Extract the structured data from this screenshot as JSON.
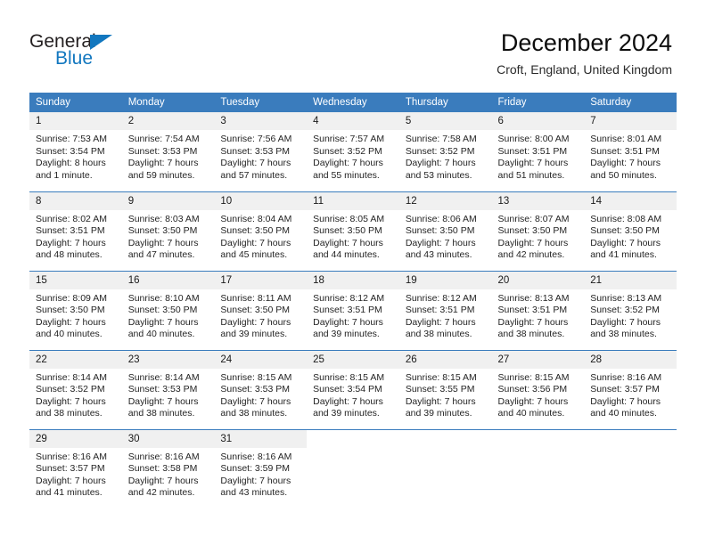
{
  "brand": {
    "word_general": "General",
    "word_blue": "Blue",
    "triangle_color": "#1277bf"
  },
  "header": {
    "title": "December 2024",
    "subtitle": "Croft, England, United Kingdom",
    "accent_color": "#3a7cbd",
    "daynum_band_color": "#f0f0f0"
  },
  "labels": {
    "sunrise_prefix": "Sunrise:",
    "sunset_prefix": "Sunset:",
    "daylight_prefix": "Daylight:"
  },
  "calendar": {
    "weekday_headers": [
      "Sunday",
      "Monday",
      "Tuesday",
      "Wednesday",
      "Thursday",
      "Friday",
      "Saturday"
    ],
    "weeks": [
      [
        {
          "day": "1",
          "sunrise": "Sunrise: 7:53 AM",
          "sunset": "Sunset: 3:54 PM",
          "daylight_l1": "Daylight: 8 hours",
          "daylight_l2": "and 1 minute."
        },
        {
          "day": "2",
          "sunrise": "Sunrise: 7:54 AM",
          "sunset": "Sunset: 3:53 PM",
          "daylight_l1": "Daylight: 7 hours",
          "daylight_l2": "and 59 minutes."
        },
        {
          "day": "3",
          "sunrise": "Sunrise: 7:56 AM",
          "sunset": "Sunset: 3:53 PM",
          "daylight_l1": "Daylight: 7 hours",
          "daylight_l2": "and 57 minutes."
        },
        {
          "day": "4",
          "sunrise": "Sunrise: 7:57 AM",
          "sunset": "Sunset: 3:52 PM",
          "daylight_l1": "Daylight: 7 hours",
          "daylight_l2": "and 55 minutes."
        },
        {
          "day": "5",
          "sunrise": "Sunrise: 7:58 AM",
          "sunset": "Sunset: 3:52 PM",
          "daylight_l1": "Daylight: 7 hours",
          "daylight_l2": "and 53 minutes."
        },
        {
          "day": "6",
          "sunrise": "Sunrise: 8:00 AM",
          "sunset": "Sunset: 3:51 PM",
          "daylight_l1": "Daylight: 7 hours",
          "daylight_l2": "and 51 minutes."
        },
        {
          "day": "7",
          "sunrise": "Sunrise: 8:01 AM",
          "sunset": "Sunset: 3:51 PM",
          "daylight_l1": "Daylight: 7 hours",
          "daylight_l2": "and 50 minutes."
        }
      ],
      [
        {
          "day": "8",
          "sunrise": "Sunrise: 8:02 AM",
          "sunset": "Sunset: 3:51 PM",
          "daylight_l1": "Daylight: 7 hours",
          "daylight_l2": "and 48 minutes."
        },
        {
          "day": "9",
          "sunrise": "Sunrise: 8:03 AM",
          "sunset": "Sunset: 3:50 PM",
          "daylight_l1": "Daylight: 7 hours",
          "daylight_l2": "and 47 minutes."
        },
        {
          "day": "10",
          "sunrise": "Sunrise: 8:04 AM",
          "sunset": "Sunset: 3:50 PM",
          "daylight_l1": "Daylight: 7 hours",
          "daylight_l2": "and 45 minutes."
        },
        {
          "day": "11",
          "sunrise": "Sunrise: 8:05 AM",
          "sunset": "Sunset: 3:50 PM",
          "daylight_l1": "Daylight: 7 hours",
          "daylight_l2": "and 44 minutes."
        },
        {
          "day": "12",
          "sunrise": "Sunrise: 8:06 AM",
          "sunset": "Sunset: 3:50 PM",
          "daylight_l1": "Daylight: 7 hours",
          "daylight_l2": "and 43 minutes."
        },
        {
          "day": "13",
          "sunrise": "Sunrise: 8:07 AM",
          "sunset": "Sunset: 3:50 PM",
          "daylight_l1": "Daylight: 7 hours",
          "daylight_l2": "and 42 minutes."
        },
        {
          "day": "14",
          "sunrise": "Sunrise: 8:08 AM",
          "sunset": "Sunset: 3:50 PM",
          "daylight_l1": "Daylight: 7 hours",
          "daylight_l2": "and 41 minutes."
        }
      ],
      [
        {
          "day": "15",
          "sunrise": "Sunrise: 8:09 AM",
          "sunset": "Sunset: 3:50 PM",
          "daylight_l1": "Daylight: 7 hours",
          "daylight_l2": "and 40 minutes."
        },
        {
          "day": "16",
          "sunrise": "Sunrise: 8:10 AM",
          "sunset": "Sunset: 3:50 PM",
          "daylight_l1": "Daylight: 7 hours",
          "daylight_l2": "and 40 minutes."
        },
        {
          "day": "17",
          "sunrise": "Sunrise: 8:11 AM",
          "sunset": "Sunset: 3:50 PM",
          "daylight_l1": "Daylight: 7 hours",
          "daylight_l2": "and 39 minutes."
        },
        {
          "day": "18",
          "sunrise": "Sunrise: 8:12 AM",
          "sunset": "Sunset: 3:51 PM",
          "daylight_l1": "Daylight: 7 hours",
          "daylight_l2": "and 39 minutes."
        },
        {
          "day": "19",
          "sunrise": "Sunrise: 8:12 AM",
          "sunset": "Sunset: 3:51 PM",
          "daylight_l1": "Daylight: 7 hours",
          "daylight_l2": "and 38 minutes."
        },
        {
          "day": "20",
          "sunrise": "Sunrise: 8:13 AM",
          "sunset": "Sunset: 3:51 PM",
          "daylight_l1": "Daylight: 7 hours",
          "daylight_l2": "and 38 minutes."
        },
        {
          "day": "21",
          "sunrise": "Sunrise: 8:13 AM",
          "sunset": "Sunset: 3:52 PM",
          "daylight_l1": "Daylight: 7 hours",
          "daylight_l2": "and 38 minutes."
        }
      ],
      [
        {
          "day": "22",
          "sunrise": "Sunrise: 8:14 AM",
          "sunset": "Sunset: 3:52 PM",
          "daylight_l1": "Daylight: 7 hours",
          "daylight_l2": "and 38 minutes."
        },
        {
          "day": "23",
          "sunrise": "Sunrise: 8:14 AM",
          "sunset": "Sunset: 3:53 PM",
          "daylight_l1": "Daylight: 7 hours",
          "daylight_l2": "and 38 minutes."
        },
        {
          "day": "24",
          "sunrise": "Sunrise: 8:15 AM",
          "sunset": "Sunset: 3:53 PM",
          "daylight_l1": "Daylight: 7 hours",
          "daylight_l2": "and 38 minutes."
        },
        {
          "day": "25",
          "sunrise": "Sunrise: 8:15 AM",
          "sunset": "Sunset: 3:54 PM",
          "daylight_l1": "Daylight: 7 hours",
          "daylight_l2": "and 39 minutes."
        },
        {
          "day": "26",
          "sunrise": "Sunrise: 8:15 AM",
          "sunset": "Sunset: 3:55 PM",
          "daylight_l1": "Daylight: 7 hours",
          "daylight_l2": "and 39 minutes."
        },
        {
          "day": "27",
          "sunrise": "Sunrise: 8:15 AM",
          "sunset": "Sunset: 3:56 PM",
          "daylight_l1": "Daylight: 7 hours",
          "daylight_l2": "and 40 minutes."
        },
        {
          "day": "28",
          "sunrise": "Sunrise: 8:16 AM",
          "sunset": "Sunset: 3:57 PM",
          "daylight_l1": "Daylight: 7 hours",
          "daylight_l2": "and 40 minutes."
        }
      ],
      [
        {
          "day": "29",
          "sunrise": "Sunrise: 8:16 AM",
          "sunset": "Sunset: 3:57 PM",
          "daylight_l1": "Daylight: 7 hours",
          "daylight_l2": "and 41 minutes."
        },
        {
          "day": "30",
          "sunrise": "Sunrise: 8:16 AM",
          "sunset": "Sunset: 3:58 PM",
          "daylight_l1": "Daylight: 7 hours",
          "daylight_l2": "and 42 minutes."
        },
        {
          "day": "31",
          "sunrise": "Sunrise: 8:16 AM",
          "sunset": "Sunset: 3:59 PM",
          "daylight_l1": "Daylight: 7 hours",
          "daylight_l2": "and 43 minutes."
        },
        {
          "day": "",
          "sunrise": "",
          "sunset": "",
          "daylight_l1": "",
          "daylight_l2": ""
        },
        {
          "day": "",
          "sunrise": "",
          "sunset": "",
          "daylight_l1": "",
          "daylight_l2": ""
        },
        {
          "day": "",
          "sunrise": "",
          "sunset": "",
          "daylight_l1": "",
          "daylight_l2": ""
        },
        {
          "day": "",
          "sunrise": "",
          "sunset": "",
          "daylight_l1": "",
          "daylight_l2": ""
        }
      ]
    ]
  }
}
